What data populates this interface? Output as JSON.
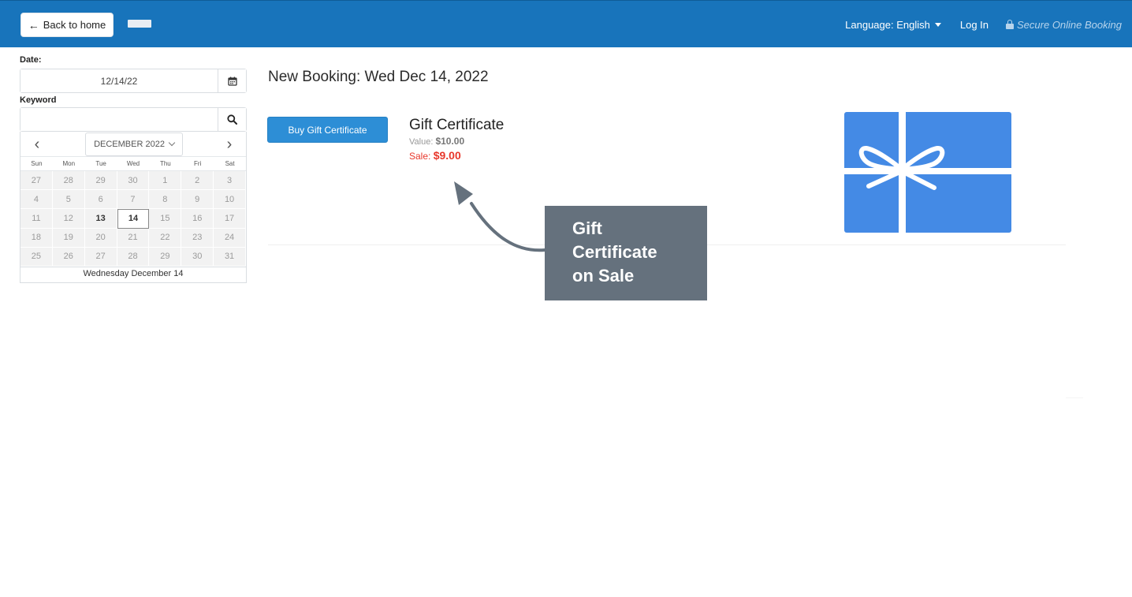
{
  "header": {
    "back_button": "Back to home",
    "language": "Language: English",
    "login": "Log In",
    "secure": "Secure Online Booking"
  },
  "sidebar": {
    "date_label": "Date:",
    "date_value": "12/14/22",
    "keyword_label": "Keyword",
    "keyword_value": "",
    "calendar": {
      "month": "DECEMBER 2022",
      "weekdays": [
        "Sun",
        "Mon",
        "Tue",
        "Wed",
        "Thu",
        "Fri",
        "Sat"
      ],
      "days": [
        "27",
        "28",
        "29",
        "30",
        "1",
        "2",
        "3",
        "4",
        "5",
        "6",
        "7",
        "8",
        "9",
        "10",
        "11",
        "12",
        "13",
        "14",
        "15",
        "16",
        "17",
        "18",
        "19",
        "20",
        "21",
        "22",
        "23",
        "24",
        "25",
        "26",
        "27",
        "28",
        "29",
        "30",
        "31"
      ],
      "today": "13",
      "selected": "14",
      "footer": "Wednesday December 14"
    }
  },
  "main": {
    "heading": "New Booking: Wed Dec 14, 2022",
    "buy_button": "Buy Gift Certificate",
    "product_title": "Gift Certificate",
    "value_label": "Value:",
    "value_amount": "$10.00",
    "sale_label": "Sale:",
    "sale_amount": "$9.00"
  },
  "callout": {
    "lines": [
      "Gift",
      "Certificate",
      "on Sale"
    ]
  },
  "colors": {
    "nav": "#1874bb",
    "button": "#2d8ed6",
    "sale": "#e8382c",
    "gift_card": "#448ae5",
    "callout": "#65717d"
  },
  "icons": [
    "arrow-left-icon",
    "caret-down-icon",
    "lock-icon",
    "calendar-icon",
    "search-icon",
    "chevron-left-icon",
    "chevron-right-icon",
    "gift-card-icon"
  ]
}
